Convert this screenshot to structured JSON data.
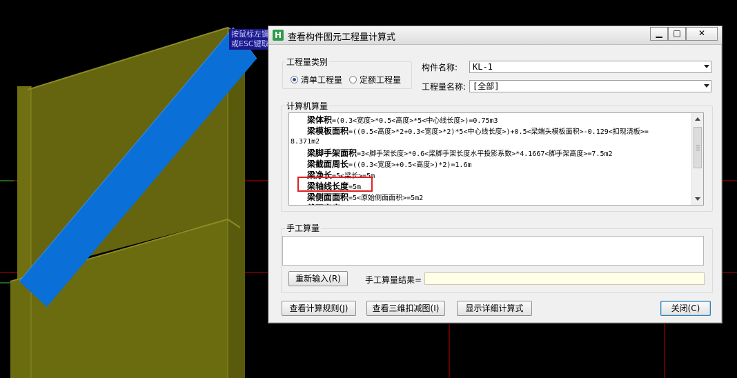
{
  "cad_tooltip": {
    "line1": "按鼠标左键",
    "line2": "或ESC键取"
  },
  "dialog": {
    "title": "查看构件图元工程量计算式",
    "app_icon_glyph": "H",
    "window_buttons": {
      "minimize": "▁",
      "maximize": "□",
      "close": "✕"
    },
    "quantity_type": {
      "group_title": "工程量类别",
      "options": [
        "清单工程量",
        "定额工程量"
      ],
      "selected_index": 0
    },
    "component_name": {
      "label": "构件名称:",
      "value": "KL-1"
    },
    "quantity_name": {
      "label": "工程量名称:",
      "value": "[全部]"
    },
    "machine_calc": {
      "group_title": "计算机算量",
      "lines": [
        {
          "name": "梁体积",
          "expr": "=(0.3<宽度>*0.5<高度>*5<中心线长度>)=0.75m3"
        },
        {
          "name": "梁模板面积",
          "expr": "=((0.5<高度>*2+0.3<宽度>*2)*5<中心线长度>)+0.5<梁端头模板面积>-0.129<扣现浇板>="
        },
        {
          "name": "",
          "expr": "8.371m2"
        },
        {
          "name": "梁脚手架面积",
          "expr": "=3<脚手架长度>*0.6<梁脚手架长度水平投影系数>*4.1667<脚手架高度>=7.5m2"
        },
        {
          "name": "梁截面周长",
          "expr": "=((0.3<宽度>+0.5<高度>)*2)=1.6m"
        },
        {
          "name": "梁净长",
          "expr": "=5<梁长>=5m"
        },
        {
          "name": "梁轴线长度",
          "expr": "=5m"
        },
        {
          "name": "梁侧面面积",
          "expr": "=5<原始侧面面积>=5m2"
        },
        {
          "name": "截面宽度",
          "expr": ""
        }
      ]
    },
    "manual_calc": {
      "group_title": "手工算量",
      "reinput_button": "重新输入(R)",
      "result_label": "手工算量结果=",
      "result_value": ""
    },
    "bottom_buttons": {
      "view_rules": "查看计算规则(J)",
      "view_3d": "查看三维扣减图(I)",
      "show_detail": "显示详细计算式",
      "close": "关闭(C)"
    }
  },
  "colors": {
    "beam_blue": "#0a6fd6",
    "wall_olive": "#6b6b10",
    "highlight_red": "#e02020",
    "grid_red": "#c80000"
  }
}
